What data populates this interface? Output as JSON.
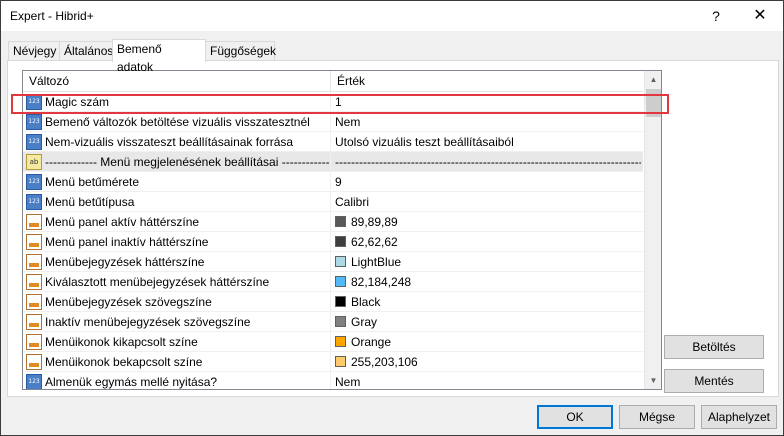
{
  "window": {
    "title": "Expert - Hibrid+",
    "help_label": "?",
    "close_label": "✕"
  },
  "tabs": [
    {
      "label": "Névjegy"
    },
    {
      "label": "Általános"
    },
    {
      "label": "Bemenő adatok"
    },
    {
      "label": "Függőségek"
    }
  ],
  "grid": {
    "col_name": "Változó",
    "col_value": "Érték",
    "rows": [
      {
        "icon": "int",
        "name": "Magic szám",
        "value": "1"
      },
      {
        "icon": "int",
        "name": "Bemenő változók betöltése vizuális visszatesztnél",
        "value": "Nem"
      },
      {
        "icon": "int",
        "name": "Nem-vizuális visszateszt beállításainak forrása",
        "value": "Utolsó vizuális teszt beállításaiból"
      },
      {
        "icon": "str",
        "name": "------------- Menü megjelenésének beállításai --------------",
        "value": "--------------------------------------------------------------------------------------"
      },
      {
        "icon": "int",
        "name": "Menü betűmérete",
        "value": "9"
      },
      {
        "icon": "int",
        "name": "Menü betűtípusa",
        "value": "Calibri"
      },
      {
        "icon": "color",
        "name": "Menü panel aktív háttérszíne",
        "value": "89,89,89",
        "swatch": "#595959"
      },
      {
        "icon": "color",
        "name": "Menü panel inaktív háttérszíne",
        "value": "62,62,62",
        "swatch": "#3e3e3e"
      },
      {
        "icon": "color",
        "name": "Menübejegyzések háttérszíne",
        "value": "LightBlue",
        "swatch": "#add8e6"
      },
      {
        "icon": "color",
        "name": "Kiválasztott menübejegyzések háttérszíne",
        "value": "82,184,248",
        "swatch": "#52b8f8"
      },
      {
        "icon": "color",
        "name": "Menübejegyzések szövegszíne",
        "value": "Black",
        "swatch": "#000000"
      },
      {
        "icon": "color",
        "name": "Inaktív menübejegyzések szövegszíne",
        "value": "Gray",
        "swatch": "#808080"
      },
      {
        "icon": "color",
        "name": "Menüikonok kikapcsolt színe",
        "value": "Orange",
        "swatch": "#ffa500"
      },
      {
        "icon": "color",
        "name": "Menüikonok bekapcsolt színe",
        "value": "255,203,106",
        "swatch": "#ffcb6a"
      },
      {
        "icon": "int",
        "name": "Almenük egymás mellé nyitása?",
        "value": "Nem"
      }
    ]
  },
  "side_buttons": {
    "load_label": "Betöltés",
    "save_label": "Mentés"
  },
  "footer_buttons": {
    "ok_label": "OK",
    "cancel_label": "Mégse",
    "reset_label": "Alaphelyzet"
  },
  "colors": {
    "highlight": "#e0383e",
    "primary_border": "#0078d7"
  }
}
